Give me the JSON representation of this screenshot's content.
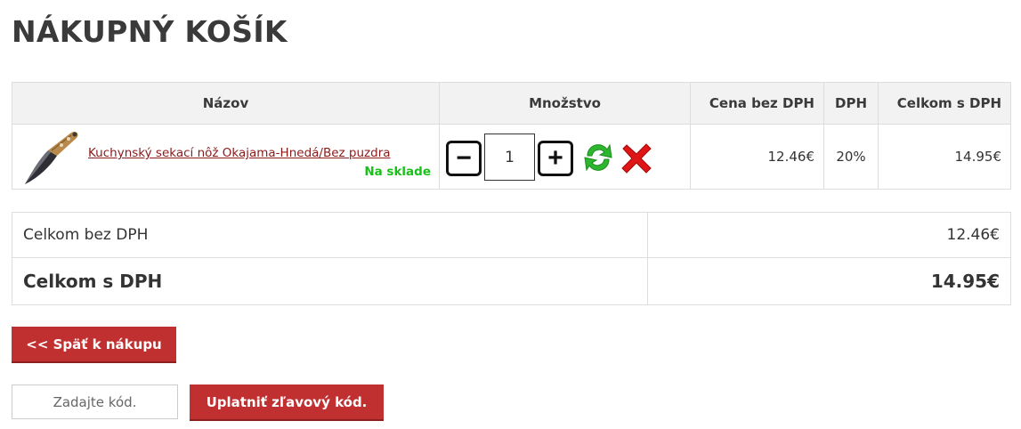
{
  "page": {
    "title": "NÁKUPNÝ KOŠÍK"
  },
  "cart": {
    "headers": {
      "name": "Názov",
      "quantity": "Množstvo",
      "price_ex_vat": "Cena bez DPH",
      "vat": "DPH",
      "total_inc_vat": "Celkom s DPH"
    },
    "items": [
      {
        "name": "Kuchynský sekací nôž Okajama-Hnedá/Bez puzdra",
        "stock": "Na sklade",
        "quantity": "1",
        "price_ex_vat": "12.46€",
        "vat": "20%",
        "total_inc_vat": "14.95€",
        "thumbnail_icon": "knife-thumbnail"
      }
    ],
    "controls": {
      "minus_label": "−",
      "plus_label": "+",
      "refresh_icon": "refresh-icon",
      "delete_icon": "delete-icon"
    }
  },
  "totals": {
    "subtotal_label": "Celkom bez DPH",
    "subtotal_value": "12.46€",
    "total_label": "Celkom s DPH",
    "total_value": "14.95€"
  },
  "actions": {
    "back_label": "<< Späť k nákupu",
    "coupon_placeholder": "Zadajte kód.",
    "apply_coupon_label": "Uplatniť zľavový kód."
  },
  "colors": {
    "accent": "#c03030",
    "stock_green": "#19c019",
    "link": "#8b1a1a",
    "header_bg": "#f2f2f2"
  }
}
